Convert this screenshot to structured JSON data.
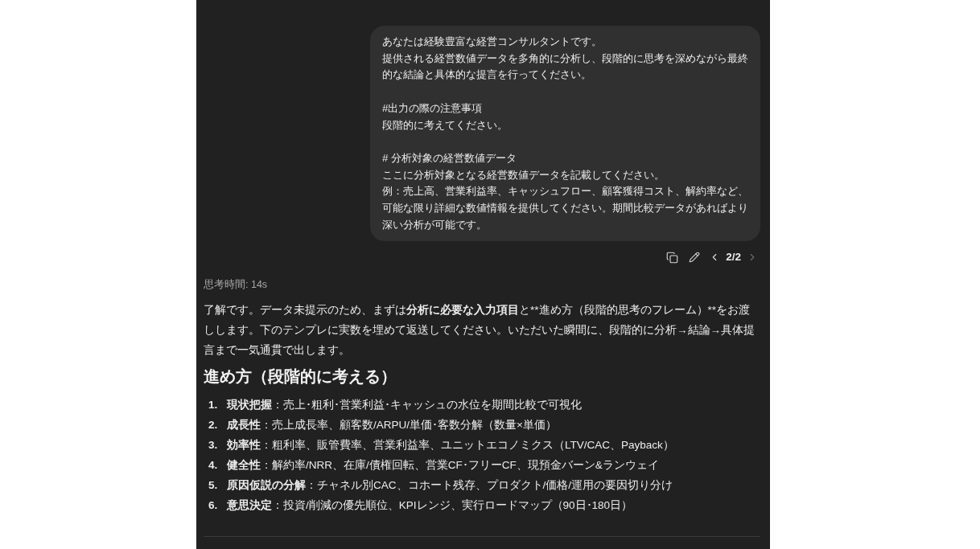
{
  "user_message": {
    "paragraphs": [
      [
        "あなたは経験豊富な経営コンサルタントです。",
        "提供される経営数値データを多角的に分析し、段階的に思考を深めながら最終的な結論と具体的な提言を行ってください。"
      ],
      [
        "#出力の際の注意事項",
        "段階的に考えてください。"
      ],
      [
        "# 分析対象の経営数値データ",
        "ここに分析対象となる経営数値データを記載してください。",
        "例：売上高、営業利益率、キャッシュフロー、顧客獲得コスト、解約率など、可能な限り詳細な数値情報を提供してください。期間比較データがあればより深い分析が可能です。"
      ]
    ]
  },
  "message_actions": {
    "pager": {
      "label": "2/2",
      "prev_disabled": false,
      "next_disabled": true
    }
  },
  "reply": {
    "thinking_time": "思考時間: 14s",
    "intro": [
      {
        "text": "了解です。データ未提示のため、まずは",
        "bold": false
      },
      {
        "text": "分析に必要な入力項目",
        "bold": true
      },
      {
        "text": "と**進め方（段階的思考のフレーム）**をお渡しします。下のテンプレに実数を埋めて返送してください。いただいた瞬間に、段階的に分析→結論→具体提言まで一気通貫で出します。",
        "bold": false
      }
    ],
    "heading": "進め方（段階的に考える）",
    "steps": [
      {
        "number": "1.",
        "text": "**現状把握**：売上･粗利･営業利益･キャッシュの水位を期間比較で可視化"
      },
      {
        "number": "2.",
        "text": "**成長性**：売上成長率、顧客数/ARPU/単価･客数分解（数量×単価）"
      },
      {
        "number": "3.",
        "text": "**効率性**：粗利率、販管費率、営業利益率、ユニットエコノミクス（LTV/CAC、Payback）"
      },
      {
        "number": "4.",
        "text": "**健全性**：解約率/NRR、在庫/債権回転、営業CF･フリーCF、現預金バーン&ランウェイ"
      },
      {
        "number": "5.",
        "text": "**原因仮説の分解**：チャネル別CAC、コホート残存、プロダクト/価格/運用の要因切り分け"
      },
      {
        "number": "6.",
        "text": "**意思決定**：投資/削減の優先順位、KPIレンジ、実行ロードマップ（90日･180日）"
      }
    ]
  }
}
